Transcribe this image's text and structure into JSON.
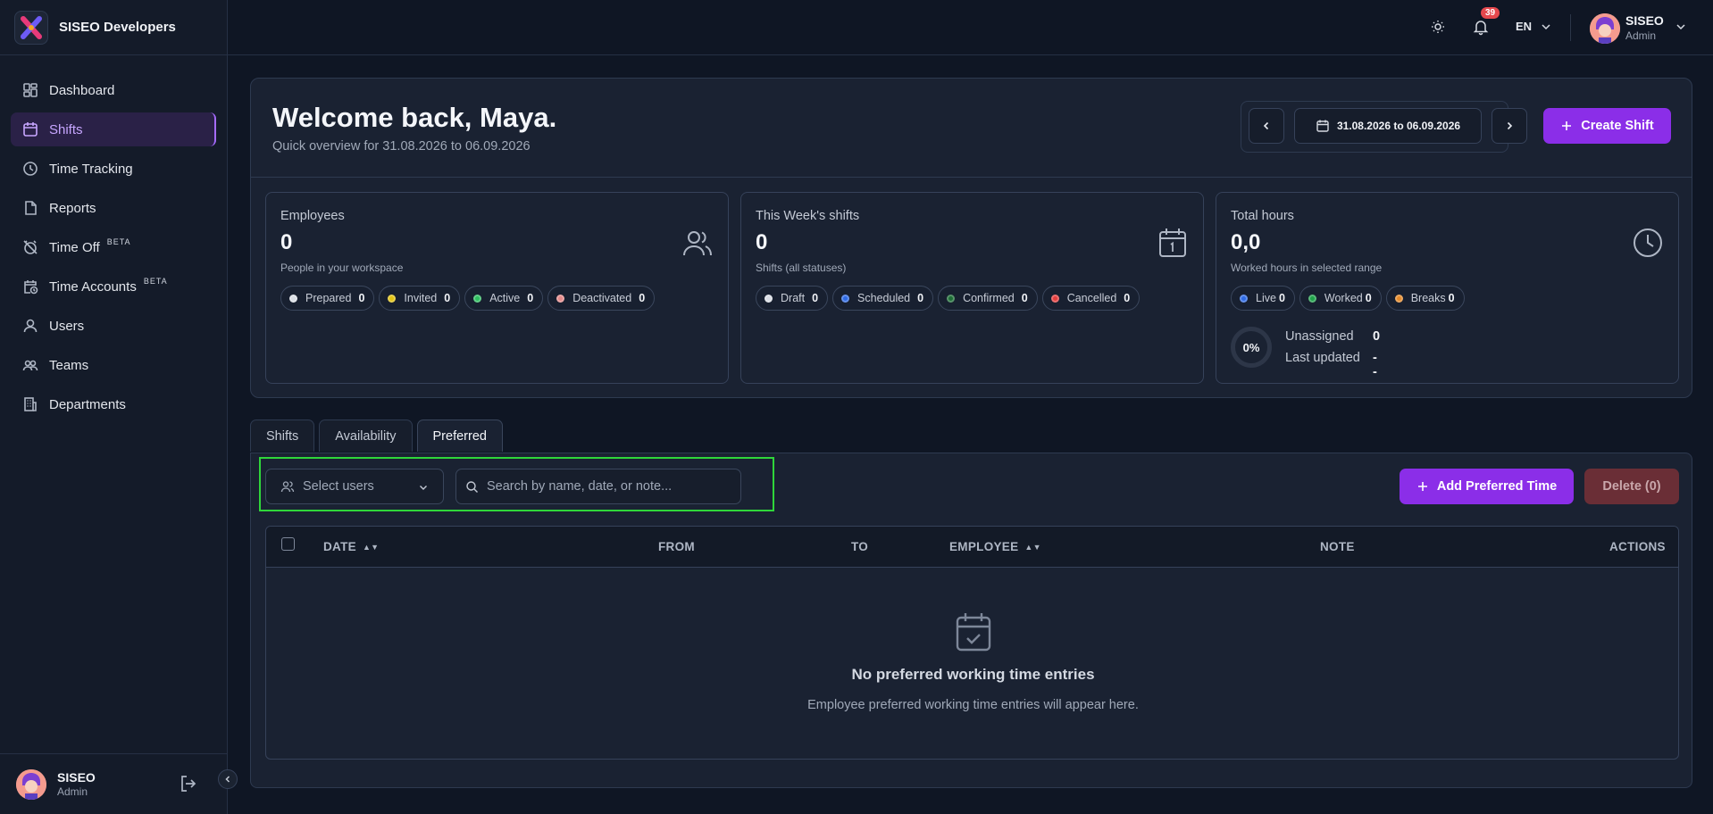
{
  "brand": {
    "name": "SISEO Developers"
  },
  "sidebar": {
    "items": [
      {
        "label": "Dashboard"
      },
      {
        "label": "Shifts"
      },
      {
        "label": "Time Tracking"
      },
      {
        "label": "Reports"
      },
      {
        "label": "Time Off",
        "badge": "BETA"
      },
      {
        "label": "Time Accounts",
        "badge": "BETA"
      },
      {
        "label": "Users"
      },
      {
        "label": "Teams"
      },
      {
        "label": "Departments"
      }
    ],
    "footer": {
      "name": "SISEO",
      "role": "Admin"
    }
  },
  "topbar": {
    "notifications": "39",
    "language": "EN",
    "user": {
      "name": "SISEO",
      "role": "Admin"
    }
  },
  "header": {
    "welcome": "Welcome back, Maya.",
    "overview": "Quick overview for 31.08.2026 to 06.09.2026",
    "date_range": "31.08.2026 to 06.09.2026",
    "create_button": "Create Shift"
  },
  "stats": {
    "employees": {
      "title": "Employees",
      "value": "0",
      "subtitle": "People in your workspace",
      "pills": [
        {
          "label": "Prepared",
          "count": "0",
          "color": "#d9dde4"
        },
        {
          "label": "Invited",
          "count": "0",
          "color": "#e3c313"
        },
        {
          "label": "Active",
          "count": "0",
          "color": "#2dbe5f"
        },
        {
          "label": "Deactivated",
          "count": "0",
          "color": "#e58a8a"
        }
      ]
    },
    "shifts": {
      "title": "This Week's shifts",
      "value": "0",
      "subtitle": "Shifts (all statuses)",
      "pills": [
        {
          "label": "Draft",
          "count": "0",
          "color": "#d9dde4"
        },
        {
          "label": "Scheduled",
          "count": "0",
          "color": "#2f6be5"
        },
        {
          "label": "Confirmed",
          "count": "0",
          "color": "#1d6e36"
        },
        {
          "label": "Cancelled",
          "count": "0",
          "color": "#e53e3e"
        }
      ]
    },
    "hours": {
      "title": "Total hours",
      "value": "0,0",
      "subtitle": "Worked hours in selected range",
      "pills": [
        {
          "label": "Live",
          "count": "0",
          "color": "#2f6be5"
        },
        {
          "label": "Worked",
          "count": "0",
          "color": "#1fa34a"
        },
        {
          "label": "Breaks",
          "count": "0",
          "color": "#e58a2a"
        }
      ],
      "ring": "0%",
      "unassigned_label": "Unassigned",
      "unassigned_value": "0",
      "updated_label": "Last updated",
      "updated_value": "--"
    }
  },
  "tabs": [
    {
      "label": "Shifts"
    },
    {
      "label": "Availability"
    },
    {
      "label": "Preferred"
    }
  ],
  "filters": {
    "select_users": "Select users",
    "search_placeholder": "Search by name, date, or note..."
  },
  "actions": {
    "add": "Add Preferred Time",
    "delete": "Delete (0)"
  },
  "table": {
    "columns": [
      "DATE",
      "FROM",
      "TO",
      "EMPLOYEE",
      "NOTE",
      "ACTIONS"
    ],
    "empty_title": "No preferred working time entries",
    "empty_subtitle": "Employee preferred working time entries will appear here."
  }
}
